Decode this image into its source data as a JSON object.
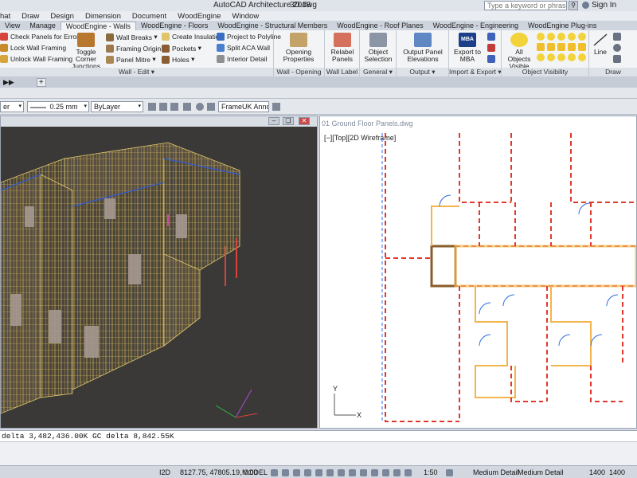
{
  "titlebar": {
    "title": "AutoCAD Architecture 2018",
    "file": "3D.dwg",
    "search_placeholder": "Type a keyword or phrase",
    "signin": "Sign In"
  },
  "menubar": [
    "hat",
    "Draw",
    "Design",
    "Dimension",
    "Document",
    "WoodEngine",
    "Window"
  ],
  "ribbon_tabs": [
    {
      "label": "View",
      "active": false
    },
    {
      "label": "Manage",
      "active": false
    },
    {
      "label": "WoodEngine - Walls",
      "active": true
    },
    {
      "label": "WoodEngine - Floors",
      "active": false
    },
    {
      "label": "WoodEngine - Structural Members",
      "active": false
    },
    {
      "label": "WoodEngine - Roof Planes",
      "active": false
    },
    {
      "label": "WoodEngine - Engineering",
      "active": false
    },
    {
      "label": "WoodEngine Plug-ins",
      "active": false
    }
  ],
  "ribbon": {
    "wall_edit": {
      "label": "Wall - Edit",
      "check_panels": "Check Panels for Errors",
      "lock_framing": "Lock Wall Framing",
      "unlock_framing": "Unlock Wall Framing",
      "toggle_junctions": "Toggle Corner Junctions",
      "wall_breaks": "Wall Breaks",
      "framing_origin": "Framing Origin",
      "panel_mitre": "Panel Mitre",
      "create_insulation": "Create Insulation",
      "pockets": "Pockets",
      "holes": "Holes",
      "project_polyline": "Project to Polyline",
      "split_aca": "Split ACA Wall",
      "interior_detail": "Interior Detail"
    },
    "wall_opening": {
      "label": "Wall - Opening",
      "opening_properties": "Opening Properties"
    },
    "wall_label": {
      "label": "Wall Label",
      "relabel": "Relabel Panels"
    },
    "general": {
      "label": "General",
      "object_selection": "Object Selection"
    },
    "output": {
      "label": "Output",
      "output_elevations": "Output Panel Elevations"
    },
    "import_export": {
      "label": "Import & Export",
      "export_mba": "Export to MBA",
      "mba_badge": "MBA"
    },
    "object_visibility": {
      "label": "Object Visibility",
      "all_visible": "All Objects Visible"
    },
    "draw": {
      "label": "Draw",
      "line": "Line"
    }
  },
  "toolbar": {
    "lineweight": "0.25 mm",
    "layer_value": "ByLayer",
    "annotation": "FrameUK Anno"
  },
  "viewports": {
    "right_title": "01 Ground Floor Panels.dwg",
    "right_label": "[−][Top][2D Wireframe]",
    "axis_y": "Y",
    "axis_x": "X"
  },
  "commandline": {
    "text": "delta 3,482,436.00K GC delta 8,842.55K"
  },
  "statusbar": {
    "mode": "I2D",
    "coords": "8127.75, 47805.19, 0.00",
    "model": "MODEL",
    "scale": "1:50",
    "detail1": "Medium Detail",
    "detail2": "Medium Detail",
    "val1": "1400",
    "val2": "1400"
  }
}
